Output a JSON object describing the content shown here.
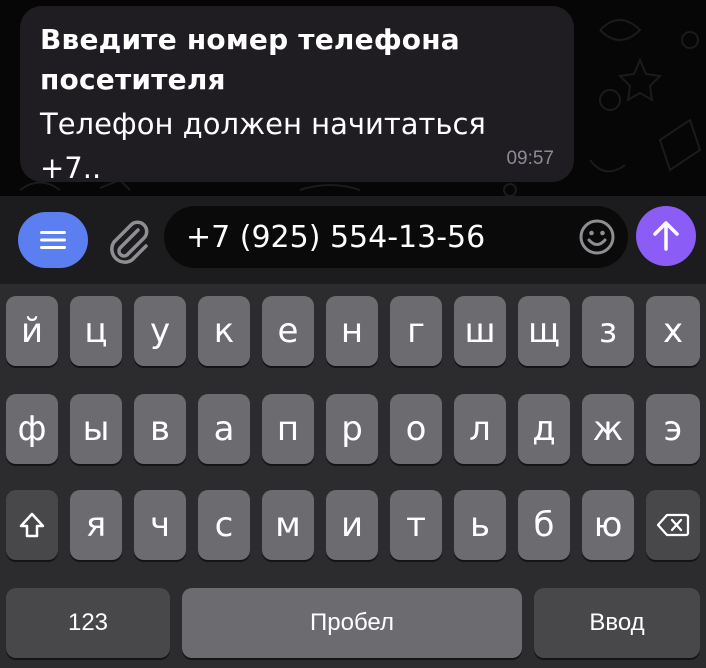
{
  "message": {
    "title": "Введите номер телефона посетителя",
    "text": "Телефон должен начитаться +7..",
    "time": "09:57"
  },
  "composer": {
    "input_value": "+7 (925) 554-13-56"
  },
  "keyboard": {
    "row1": [
      "й",
      "ц",
      "у",
      "к",
      "е",
      "н",
      "г",
      "ш",
      "щ",
      "з",
      "х"
    ],
    "row2": [
      "ф",
      "ы",
      "в",
      "а",
      "п",
      "р",
      "о",
      "л",
      "д",
      "ж",
      "э"
    ],
    "row3": [
      "я",
      "ч",
      "с",
      "м",
      "и",
      "т",
      "ь",
      "б",
      "ю"
    ],
    "numbers_label": "123",
    "space_label": "Пробел",
    "return_label": "Ввод"
  },
  "colors": {
    "menu_button": "#5b7ef0",
    "send_button": "#8b5cf6",
    "key": "#6c6c70",
    "key_dark": "#48484a"
  }
}
